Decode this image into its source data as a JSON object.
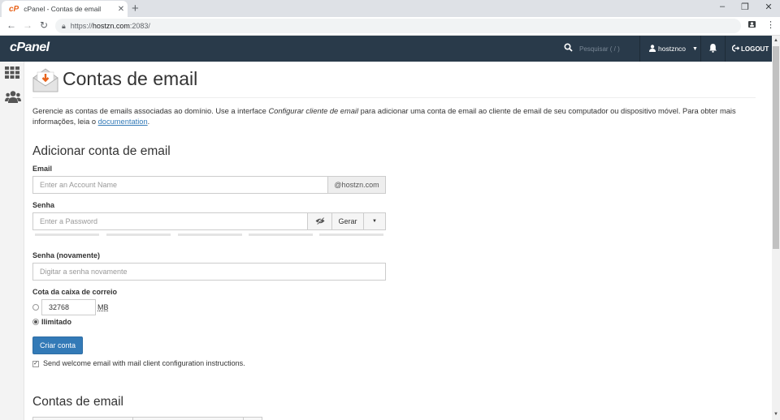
{
  "browser": {
    "tab_title": "cPanel - Contas de email",
    "tab_close": "✕",
    "new_tab": "+",
    "url_scheme": "https://",
    "url_host": "hostzn.com",
    "url_rest": ":2083/",
    "minimize": "–",
    "restore": "❐",
    "close": "✕",
    "back": "←",
    "forward": "→",
    "reload": "↻",
    "menu": "⋮"
  },
  "header": {
    "logo": "cPanel",
    "search_placeholder": "Pesquisar ( / )",
    "username": "hostznco",
    "logout": "LOGOUT"
  },
  "page": {
    "title": "Contas de email",
    "description_1": "Gerencie as contas de emails associadas ao domínio. Use a interface ",
    "description_em": "Configurar cliente de email",
    "description_2": " para adicionar uma conta de email ao cliente de email de seu computador ou dispositivo móvel. Para obter mais informações, leia o ",
    "description_link": "documentation",
    "description_end": "."
  },
  "form": {
    "section_title": "Adicionar conta de email",
    "email_label": "Email",
    "email_placeholder": "Enter an Account Name",
    "email_domain": "@hostzn.com",
    "password_label": "Senha",
    "password_placeholder": "Enter a Password",
    "generate_label": "Gerar",
    "password_again_label": "Senha (novamente)",
    "password_again_placeholder": "Digitar a senha novamente",
    "quota_label": "Cota da caixa de correio",
    "quota_value": "32768",
    "quota_unit": "MB",
    "quota_selected": "unlimited",
    "unlimited_label": "Ilimitado",
    "create_button": "Criar conta",
    "welcome_checked": true,
    "welcome_text": "Send welcome email with mail client configuration instructions."
  },
  "accounts": {
    "section_title": "Contas de email"
  },
  "colors": {
    "header_bg": "#293a4a",
    "primary": "#337ab7",
    "accent_orange": "#e8631b"
  }
}
